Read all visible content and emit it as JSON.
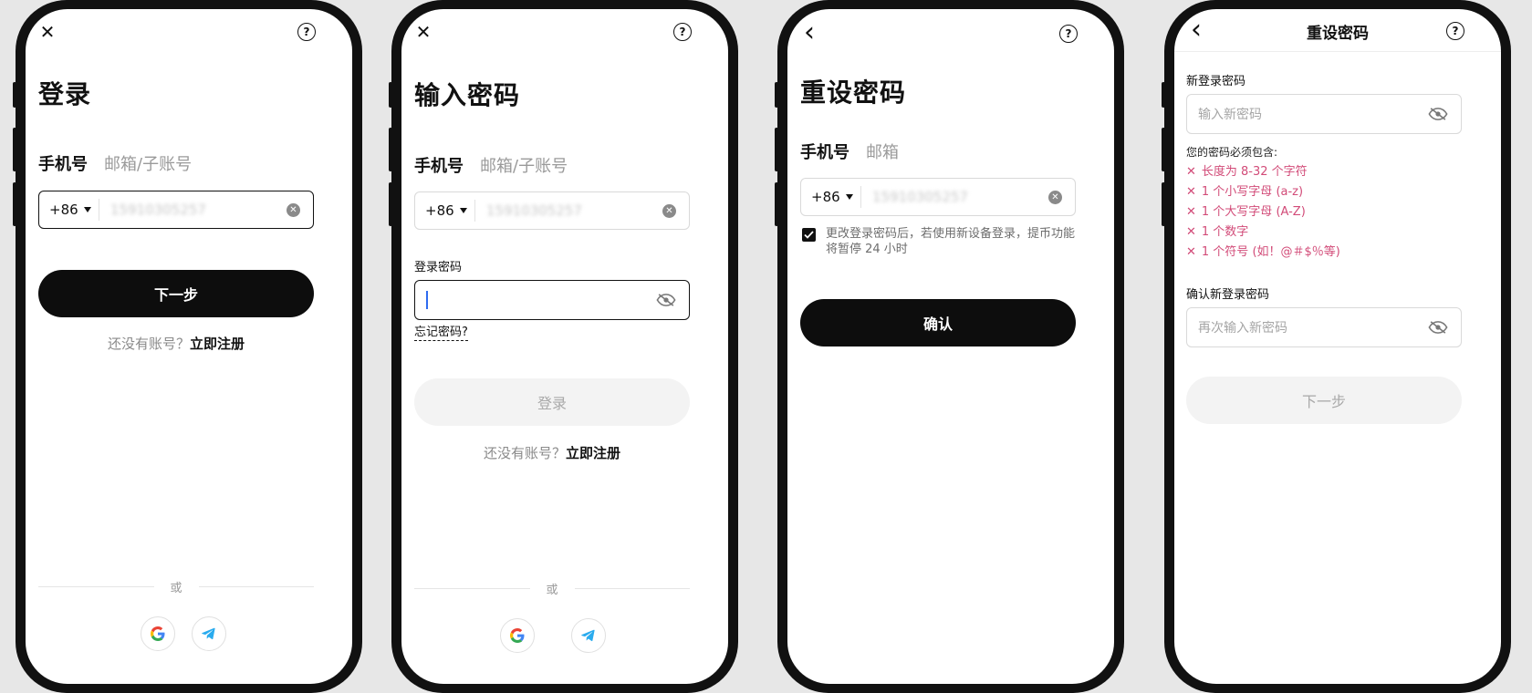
{
  "common": {
    "close_glyph": "✕",
    "back_glyph": "‹",
    "help_glyph": "?",
    "country_code": "+86",
    "phone_number": "15910305257",
    "clear_glyph": "✕",
    "or_label": "或",
    "no_account_prefix": "还没有账号？",
    "register_link": "立即注册"
  },
  "screen1": {
    "title": "登录",
    "tab_phone": "手机号",
    "tab_email": "邮箱/子账号",
    "next_button": "下一步"
  },
  "screen2": {
    "title": "输入密码",
    "tab_phone": "手机号",
    "tab_email": "邮箱/子账号",
    "password_label": "登录密码",
    "forgot_link": "忘记密码?",
    "login_button": "登录"
  },
  "screen3": {
    "title": "重设密码",
    "tab_phone": "手机号",
    "tab_email": "邮箱",
    "notice_line1": "更改登录密码后，若使用新设备登录，提币功能",
    "notice_line2": "将暂停 24 小时",
    "confirm_button": "确认"
  },
  "screen4": {
    "header_title": "重设密码",
    "new_password_label": "新登录密码",
    "new_password_placeholder": "输入新密码",
    "requirements_title": "您的密码必须包含:",
    "requirements": [
      "长度为 8-32 个字符",
      "1 个小写字母 (a-z)",
      "1 个大写字母 (A-Z)",
      "1 个数字",
      "1 个符号 (如！@＃$％等)"
    ],
    "confirm_label": "确认新登录密码",
    "confirm_placeholder": "再次输入新密码",
    "next_button": "下一步"
  },
  "colors": {
    "primary": "#0d0d0d",
    "requirement_error": "#d24b78",
    "cursor": "#2f6bf0"
  },
  "icons": [
    "close-icon",
    "help-icon",
    "back-icon",
    "clear-icon",
    "eye-off-icon",
    "google-icon",
    "telegram-icon",
    "check-icon",
    "x-mark-icon"
  ]
}
